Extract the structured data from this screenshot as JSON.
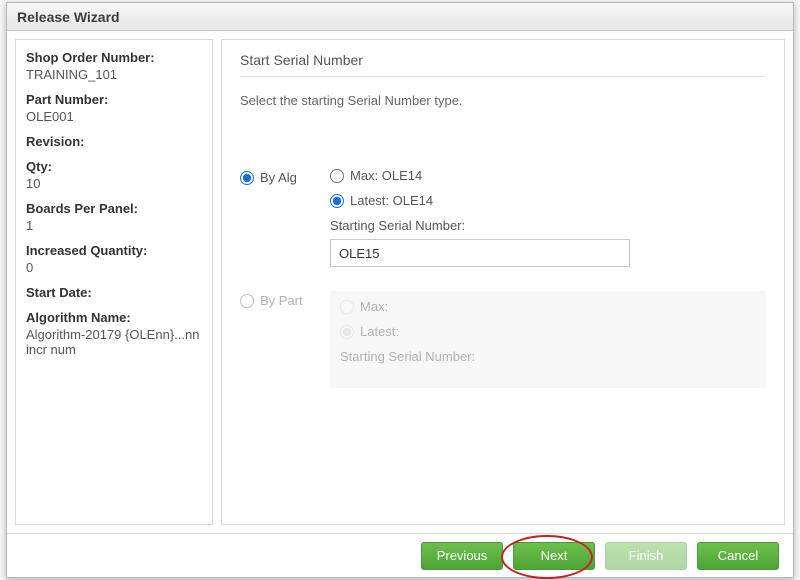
{
  "dialog": {
    "title": "Release Wizard"
  },
  "side": {
    "shop_order_number_label": "Shop Order Number:",
    "shop_order_number_value": "TRAINING_101",
    "part_number_label": "Part Number:",
    "part_number_value": "OLE001",
    "revision_label": "Revision:",
    "revision_value": "",
    "qty_label": "Qty:",
    "qty_value": "10",
    "boards_per_panel_label": "Boards Per Panel:",
    "boards_per_panel_value": "1",
    "increased_qty_label": "Increased Quantity:",
    "increased_qty_value": "0",
    "start_date_label": "Start Date:",
    "start_date_value": "",
    "algorithm_name_label": "Algorithm Name:",
    "algorithm_name_value": "Algorithm-20179 {OLEnn}...nn incr num"
  },
  "main": {
    "step_title": "Start Serial Number",
    "step_desc": "Select the starting Serial Number type.",
    "by_alg_label": "By Alg",
    "by_part_label": "By Part",
    "alg": {
      "max_label": "Max: OLE14",
      "latest_label": "Latest: OLE14",
      "starting_label": "Starting Serial Number:",
      "starting_value": "OLE15"
    },
    "part": {
      "max_label": "Max:",
      "latest_label": "Latest:",
      "starting_label": "Starting Serial Number:",
      "starting_value": ""
    }
  },
  "footer": {
    "previous": "Previous",
    "next": "Next",
    "finish": "Finish",
    "cancel": "Cancel"
  }
}
